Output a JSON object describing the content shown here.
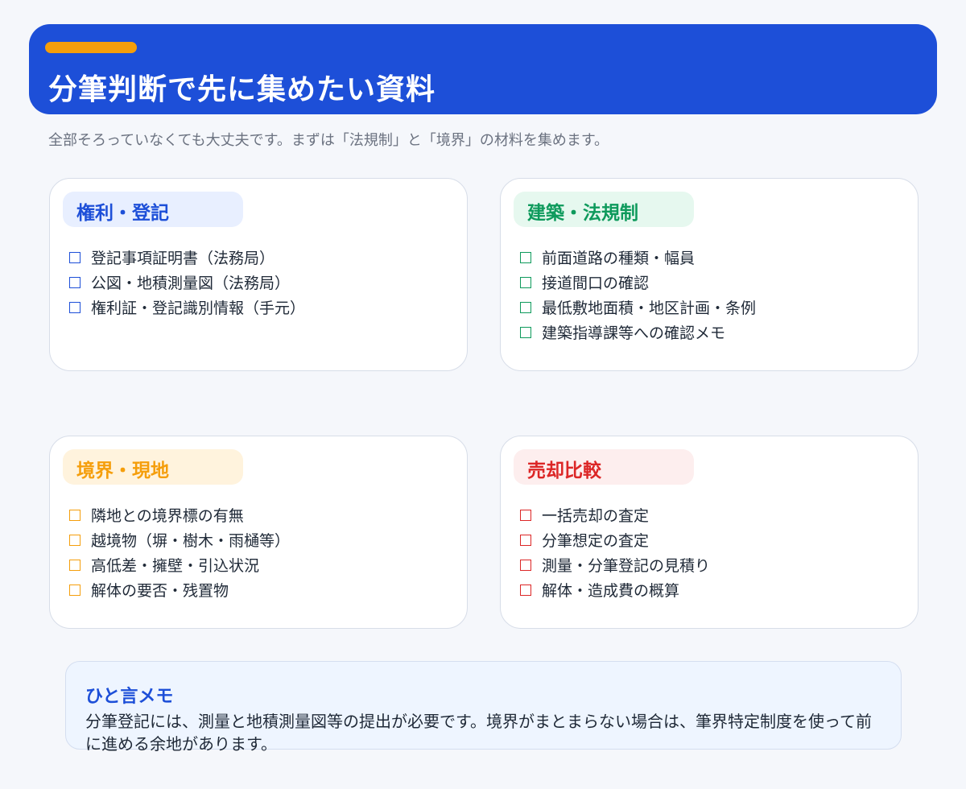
{
  "header": {
    "title": "分筆判断で先に集めたい資料",
    "accent_color": "#f59e0b",
    "background_color": "#1d4fd8"
  },
  "subtitle": "全部そろっていなくても大丈夫です。まずは「法規制」と「境界」の材料を集めます。",
  "cards": [
    {
      "title": "権利・登記",
      "color": "#1d4fd8",
      "pill_color": "#e8efff",
      "items": [
        "登記事項証明書（法務局）",
        "公図・地積測量図（法務局）",
        "権利証・登記識別情報（手元）"
      ]
    },
    {
      "title": "建築・法規制",
      "color": "#0e9a5c",
      "pill_color": "#e6f8ef",
      "items": [
        "前面道路の種類・幅員",
        "接道間口の確認",
        "最低敷地面積・地区計画・条例",
        "建築指導課等への確認メモ"
      ]
    },
    {
      "title": "境界・現地",
      "color": "#f59e0b",
      "pill_color": "#fff3dd",
      "items": [
        "隣地との境界標の有無",
        "越境物（塀・樹木・雨樋等）",
        "高低差・擁壁・引込状況",
        "解体の要否・残置物"
      ]
    },
    {
      "title": "売却比較",
      "color": "#dc2626",
      "pill_color": "#fdeeee",
      "items": [
        "一括売却の査定",
        "分筆想定の査定",
        "測量・分筆登記の見積り",
        "解体・造成費の概算"
      ]
    }
  ],
  "memo": {
    "title": "ひと言メモ",
    "body": "分筆登記には、測量と地積測量図等の提出が必要です。境界がまとまらない場合は、筆界特定制度を使って前に進める余地があります。"
  }
}
